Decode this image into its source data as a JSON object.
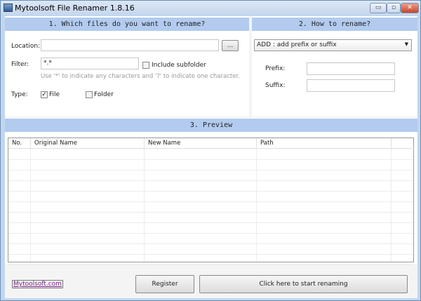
{
  "window": {
    "title": "Mytoolsoft File Renamer 1.8.16",
    "minimize": "▭",
    "maximize": "▫",
    "close": "✕"
  },
  "section1": {
    "header": "1. Which files do you want to rename?",
    "location_label": "Location:",
    "location_value": "",
    "browse_label": "...",
    "filter_label": "Filter:",
    "filter_value": "*.*",
    "include_subfolder_label": "Include subfolder",
    "include_subfolder_checked": false,
    "hint": "Use '*' to indicate any characters and '?' to indicate one character.",
    "type_label": "Type:",
    "file_label": "File",
    "file_checked": true,
    "folder_label": "Folder",
    "folder_checked": false
  },
  "section2": {
    "header": "2. How to rename?",
    "method": "ADD : add prefix or suffix",
    "prefix_label": "Prefix:",
    "prefix_value": "",
    "suffix_label": "Suffix:",
    "suffix_value": ""
  },
  "section3": {
    "header": "3. Preview",
    "columns": [
      "No.",
      "Original Name",
      "New Name",
      "Path"
    ],
    "rows": []
  },
  "footer": {
    "link": "Mytoolsoft.com",
    "register": "Register",
    "start": "Click here to start renaming"
  }
}
